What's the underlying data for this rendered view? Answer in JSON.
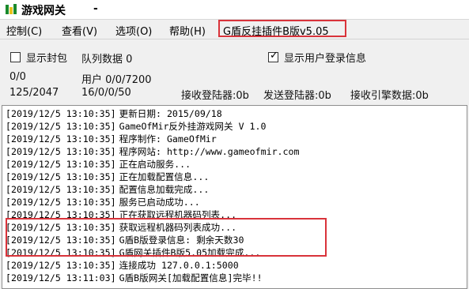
{
  "window": {
    "title": "游戏网关",
    "minimize_glyph": "-"
  },
  "menu": {
    "items": [
      "控制(C)",
      "查看(V)",
      "选项(O)",
      "帮助(H)"
    ],
    "plugin_label": "G盾反挂插件B版v5.05"
  },
  "status": {
    "show_banned": {
      "label": "显示封包",
      "checked": false
    },
    "queue": "队列数据 0",
    "show_login": {
      "label": "显示用户登录信息",
      "checked": true
    },
    "ratio1": "0/0",
    "users": "用户 0/0/7200",
    "ratio2": "125/2047",
    "ratio3": "16/0/0/50",
    "recv_login": "接收登陆器:0b",
    "send_login": "发送登陆器:0b",
    "recv_engine": "接收引擎数据:0b"
  },
  "log": {
    "entries": [
      {
        "ts": "[2019/12/5 13:10:35]",
        "msg": "更新日期: 2015/09/18"
      },
      {
        "ts": "[2019/12/5 13:10:35]",
        "msg": "GameOfMir反外挂游戏网关 V 1.0"
      },
      {
        "ts": "[2019/12/5 13:10:35]",
        "msg": "程序制作: GameOfMir"
      },
      {
        "ts": "[2019/12/5 13:10:35]",
        "msg": "程序网站: http://www.gameofmir.com"
      },
      {
        "ts": "[2019/12/5 13:10:35]",
        "msg": "正在启动服务..."
      },
      {
        "ts": "[2019/12/5 13:10:35]",
        "msg": "正在加载配置信息..."
      },
      {
        "ts": "[2019/12/5 13:10:35]",
        "msg": "配置信息加载完成..."
      },
      {
        "ts": "[2019/12/5 13:10:35]",
        "msg": "服务已启动成功..."
      },
      {
        "ts": "[2019/12/5 13:10:35]",
        "msg": "正在获取远程机器码列表..."
      },
      {
        "ts": "[2019/12/5 13:10:35]",
        "msg": "获取远程机器码列表成功..."
      },
      {
        "ts": "[2019/12/5 13:10:35]",
        "msg": "G盾B版登录信息: 剩余天数30"
      },
      {
        "ts": "[2019/12/5 13:10:35]",
        "msg": "G盾网关插件B版5.05加载完成..."
      },
      {
        "ts": "[2019/12/5 13:10:35]",
        "msg": "连接成功 127.0.0.1:5000"
      },
      {
        "ts": "[2019/12/5 13:11:03]",
        "msg": "G盾B版网关[加载配置信息]完毕!!"
      }
    ]
  },
  "colors": {
    "highlight": "#d9333a",
    "icon_green": "#1a8a2c",
    "icon_yellow": "#e8c21a"
  }
}
